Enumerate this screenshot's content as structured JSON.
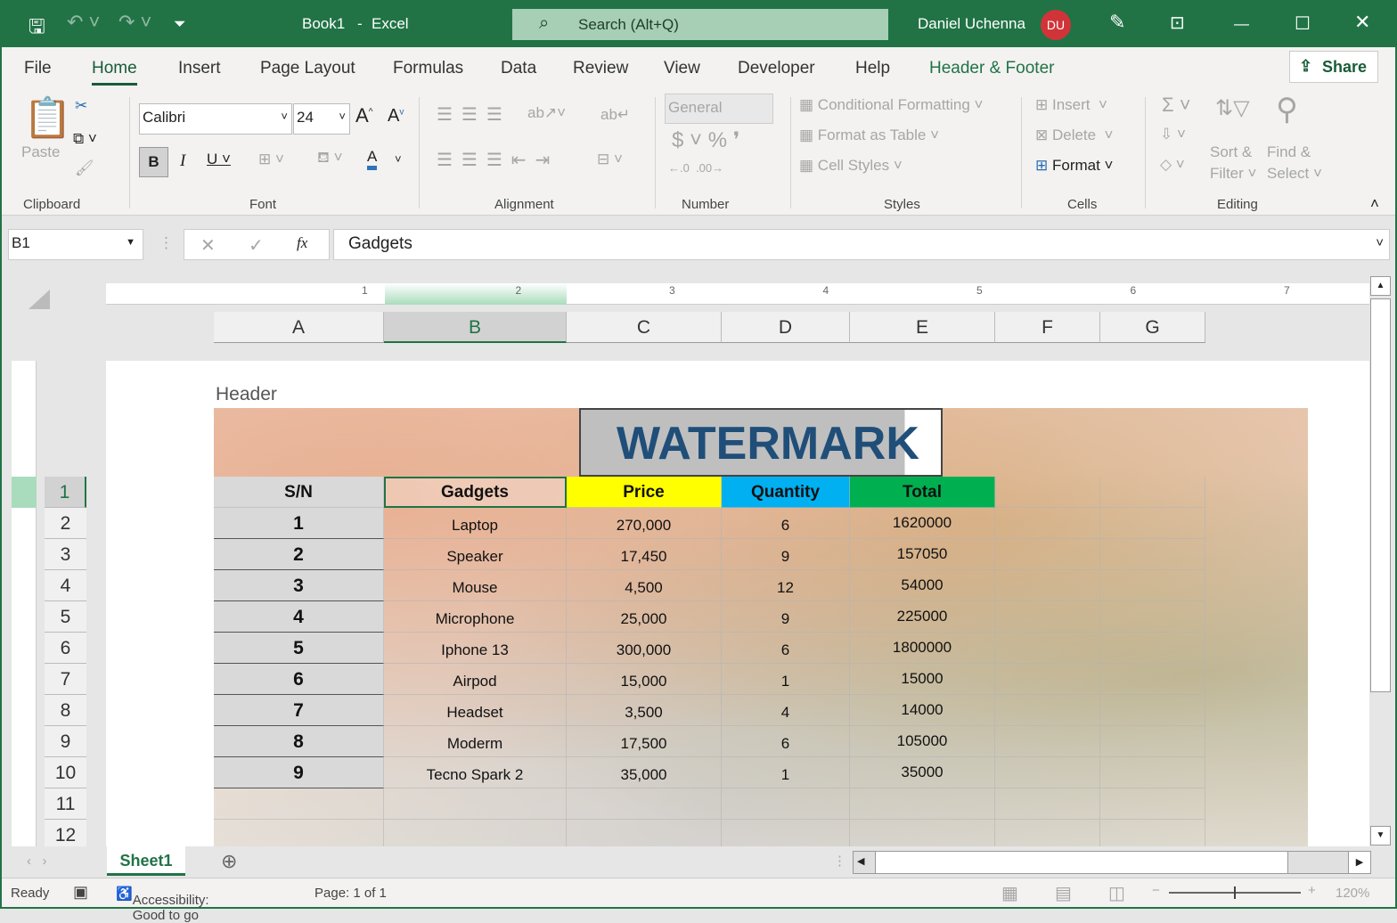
{
  "titlebar": {
    "doc": "Book1",
    "sep": "-",
    "app": "Excel",
    "search": "Search (Alt+Q)",
    "user": "Daniel Uchenna",
    "initials": "DU"
  },
  "tabs": [
    "File",
    "Home",
    "Insert",
    "Page Layout",
    "Formulas",
    "Data",
    "Review",
    "View",
    "Developer",
    "Help",
    "Header & Footer"
  ],
  "share": "Share",
  "ribbon": {
    "clipboard": {
      "paste": "Paste",
      "label": "Clipboard"
    },
    "font": {
      "name": "Calibri",
      "size": "24",
      "label": "Font"
    },
    "alignment": {
      "label": "Alignment"
    },
    "number": {
      "format": "General",
      "label": "Number"
    },
    "styles": {
      "cond": "Conditional Formatting",
      "table": "Format as Table",
      "cell": "Cell Styles",
      "label": "Styles"
    },
    "cells": {
      "insert": "Insert",
      "delete": "Delete",
      "format": "Format",
      "label": "Cells"
    },
    "editing": {
      "sort1": "Sort &",
      "sort2": "Filter",
      "find1": "Find &",
      "find2": "Select",
      "label": "Editing"
    }
  },
  "formula": {
    "namebox": "B1",
    "value": "Gadgets",
    "fx": "fx"
  },
  "columns": [
    "A",
    "B",
    "C",
    "D",
    "E",
    "F",
    "G"
  ],
  "ruler": [
    "1",
    "2",
    "3",
    "4",
    "5",
    "6",
    "7"
  ],
  "rows": [
    "1",
    "2",
    "3",
    "4",
    "5",
    "6",
    "7",
    "8",
    "9",
    "10",
    "11",
    "12"
  ],
  "header_label": "Header",
  "watermark": "WATERMARK",
  "table": {
    "headers": [
      "S/N",
      "Gadgets",
      "Price",
      "Quantity",
      "Total"
    ],
    "header_colors": [
      "#d9d9d9",
      "transparent",
      "#ffff00",
      "#00b0f0",
      "#00b050"
    ],
    "rows": [
      [
        "1",
        "Laptop",
        "270,000",
        "6",
        "1620000"
      ],
      [
        "2",
        "Speaker",
        "17,450",
        "9",
        "157050"
      ],
      [
        "3",
        "Mouse",
        "4,500",
        "12",
        "54000"
      ],
      [
        "4",
        "Microphone",
        "25,000",
        "9",
        "225000"
      ],
      [
        "5",
        "Iphone 13",
        "300,000",
        "6",
        "1800000"
      ],
      [
        "6",
        "Airpod",
        "15,000",
        "1",
        "15000"
      ],
      [
        "7",
        "Headset",
        "3,500",
        "4",
        "14000"
      ],
      [
        "8",
        "Moderm",
        "17,500",
        "6",
        "105000"
      ],
      [
        "9",
        "Tecno Spark 2",
        "35,000",
        "1",
        "35000"
      ]
    ]
  },
  "sheet": "Sheet1",
  "status": {
    "ready": "Ready",
    "accessibility": "Accessibility: Good to go",
    "page": "Page: 1 of 1",
    "zoom": "120%"
  }
}
